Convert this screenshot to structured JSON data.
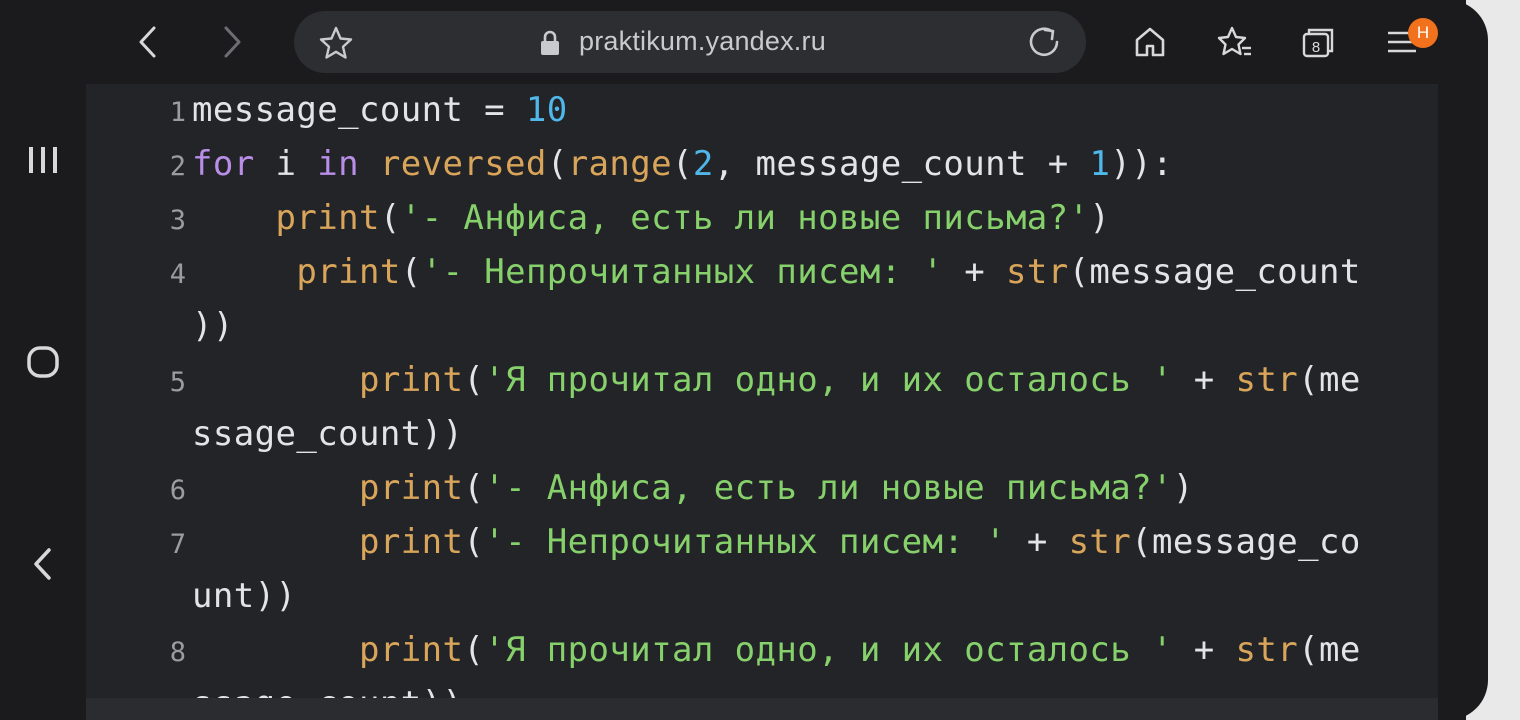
{
  "browser": {
    "url": "praktikum.yandex.ru",
    "tabs_count": "8",
    "profile_badge": "Н",
    "icons": {
      "back": "chevron-left-icon",
      "forward": "chevron-right-icon",
      "bookmark": "star-icon",
      "lock": "lock-icon",
      "reload": "reload-icon",
      "home": "home-icon",
      "favorites": "star-list-icon",
      "tabs": "tabs-icon",
      "menu": "menu-icon"
    },
    "colors": {
      "badge": "#f2711c",
      "background": "#1b1b1d",
      "url_bar": "#2d2e31"
    }
  },
  "system_nav": {
    "recents": "III",
    "home": "O",
    "back": "<"
  },
  "editor": {
    "colors": {
      "keyword": "#b98ee8",
      "function": "#d9a55a",
      "number": "#4fb7e9",
      "string": "#86d16b",
      "text": "#e4e4e6"
    },
    "lines": [
      {
        "num": "1",
        "segments": [
          {
            "t": "message_count = ",
            "c": ""
          },
          {
            "t": "10",
            "c": "num"
          }
        ]
      },
      {
        "num": "2",
        "segments": [
          {
            "t": "for",
            "c": "kw"
          },
          {
            "t": " i ",
            "c": ""
          },
          {
            "t": "in",
            "c": "kw"
          },
          {
            "t": " ",
            "c": ""
          },
          {
            "t": "reversed",
            "c": "fn"
          },
          {
            "t": "(",
            "c": ""
          },
          {
            "t": "range",
            "c": "fn"
          },
          {
            "t": "(",
            "c": ""
          },
          {
            "t": "2",
            "c": "num"
          },
          {
            "t": ", message_count + ",
            "c": ""
          },
          {
            "t": "1",
            "c": "num"
          },
          {
            "t": ")):",
            "c": ""
          }
        ]
      },
      {
        "num": "3",
        "segments": [
          {
            "t": "    ",
            "c": ""
          },
          {
            "t": "print",
            "c": "fn"
          },
          {
            "t": "(",
            "c": ""
          },
          {
            "t": "'- Анфиса, есть ли новые письма?'",
            "c": "str"
          },
          {
            "t": ")",
            "c": ""
          }
        ]
      },
      {
        "num": "4",
        "segments": [
          {
            "t": "     ",
            "c": ""
          },
          {
            "t": "print",
            "c": "fn"
          },
          {
            "t": "(",
            "c": ""
          },
          {
            "t": "'- Непрочитанных писем: '",
            "c": "str"
          },
          {
            "t": " + ",
            "c": ""
          },
          {
            "t": "str",
            "c": "fn"
          },
          {
            "t": "(message_count",
            "c": ""
          }
        ]
      },
      {
        "num": "",
        "segments": [
          {
            "t": "))",
            "c": ""
          }
        ]
      },
      {
        "num": "5",
        "segments": [
          {
            "t": "        ",
            "c": ""
          },
          {
            "t": "print",
            "c": "fn"
          },
          {
            "t": "(",
            "c": ""
          },
          {
            "t": "'Я прочитал одно, и их осталось '",
            "c": "str"
          },
          {
            "t": " + ",
            "c": ""
          },
          {
            "t": "str",
            "c": "fn"
          },
          {
            "t": "(me",
            "c": ""
          }
        ]
      },
      {
        "num": "",
        "segments": [
          {
            "t": "ssage_count))",
            "c": ""
          }
        ]
      },
      {
        "num": "6",
        "segments": [
          {
            "t": "        ",
            "c": ""
          },
          {
            "t": "print",
            "c": "fn"
          },
          {
            "t": "(",
            "c": ""
          },
          {
            "t": "'- Анфиса, есть ли новые письма?'",
            "c": "str"
          },
          {
            "t": ")",
            "c": ""
          }
        ]
      },
      {
        "num": "7",
        "segments": [
          {
            "t": "        ",
            "c": ""
          },
          {
            "t": "print",
            "c": "fn"
          },
          {
            "t": "(",
            "c": ""
          },
          {
            "t": "'- Непрочитанных писем: '",
            "c": "str"
          },
          {
            "t": " + ",
            "c": ""
          },
          {
            "t": "str",
            "c": "fn"
          },
          {
            "t": "(message_co",
            "c": ""
          }
        ]
      },
      {
        "num": "",
        "segments": [
          {
            "t": "unt))",
            "c": ""
          }
        ]
      },
      {
        "num": "8",
        "segments": [
          {
            "t": "        ",
            "c": ""
          },
          {
            "t": "print",
            "c": "fn"
          },
          {
            "t": "(",
            "c": ""
          },
          {
            "t": "'Я прочитал одно, и их осталось '",
            "c": "str"
          },
          {
            "t": " + ",
            "c": ""
          },
          {
            "t": "str",
            "c": "fn"
          },
          {
            "t": "(me",
            "c": ""
          }
        ]
      },
      {
        "num": "",
        "segments": [
          {
            "t": "ssage_count))",
            "c": ""
          }
        ]
      }
    ]
  }
}
